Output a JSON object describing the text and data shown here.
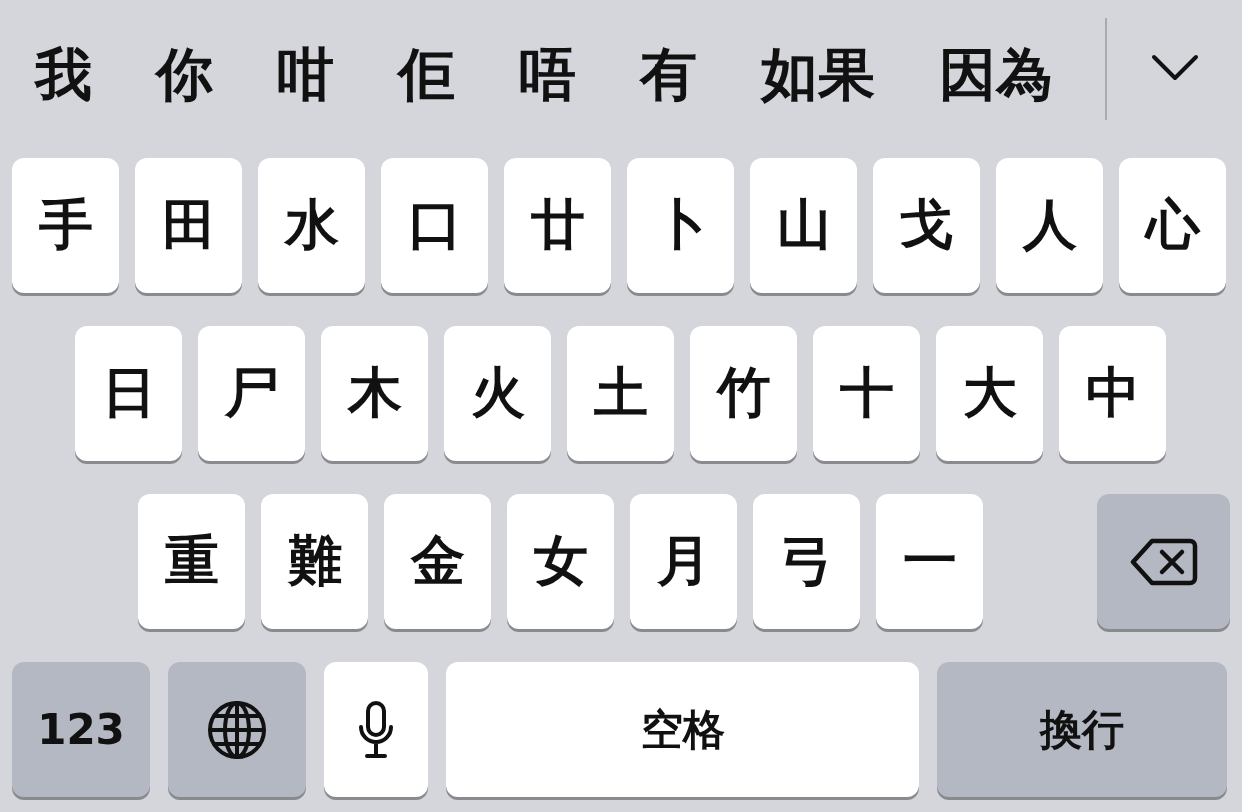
{
  "candidates": [
    "我",
    "你",
    "咁",
    "佢",
    "唔",
    "有",
    "如果",
    "因為"
  ],
  "rows": [
    [
      "手",
      "田",
      "水",
      "口",
      "廿",
      "卜",
      "山",
      "戈",
      "人",
      "心"
    ],
    [
      "日",
      "尸",
      "木",
      "火",
      "土",
      "竹",
      "十",
      "大",
      "中"
    ],
    [
      "重",
      "難",
      "金",
      "女",
      "月",
      "弓",
      "一"
    ]
  ],
  "bottom": [
    {
      "kind": "function",
      "label": "123"
    },
    {
      "kind": "globe"
    },
    {
      "kind": "mic"
    },
    {
      "kind": "space",
      "label": "空格"
    },
    {
      "kind": "function",
      "label": "換行"
    }
  ]
}
